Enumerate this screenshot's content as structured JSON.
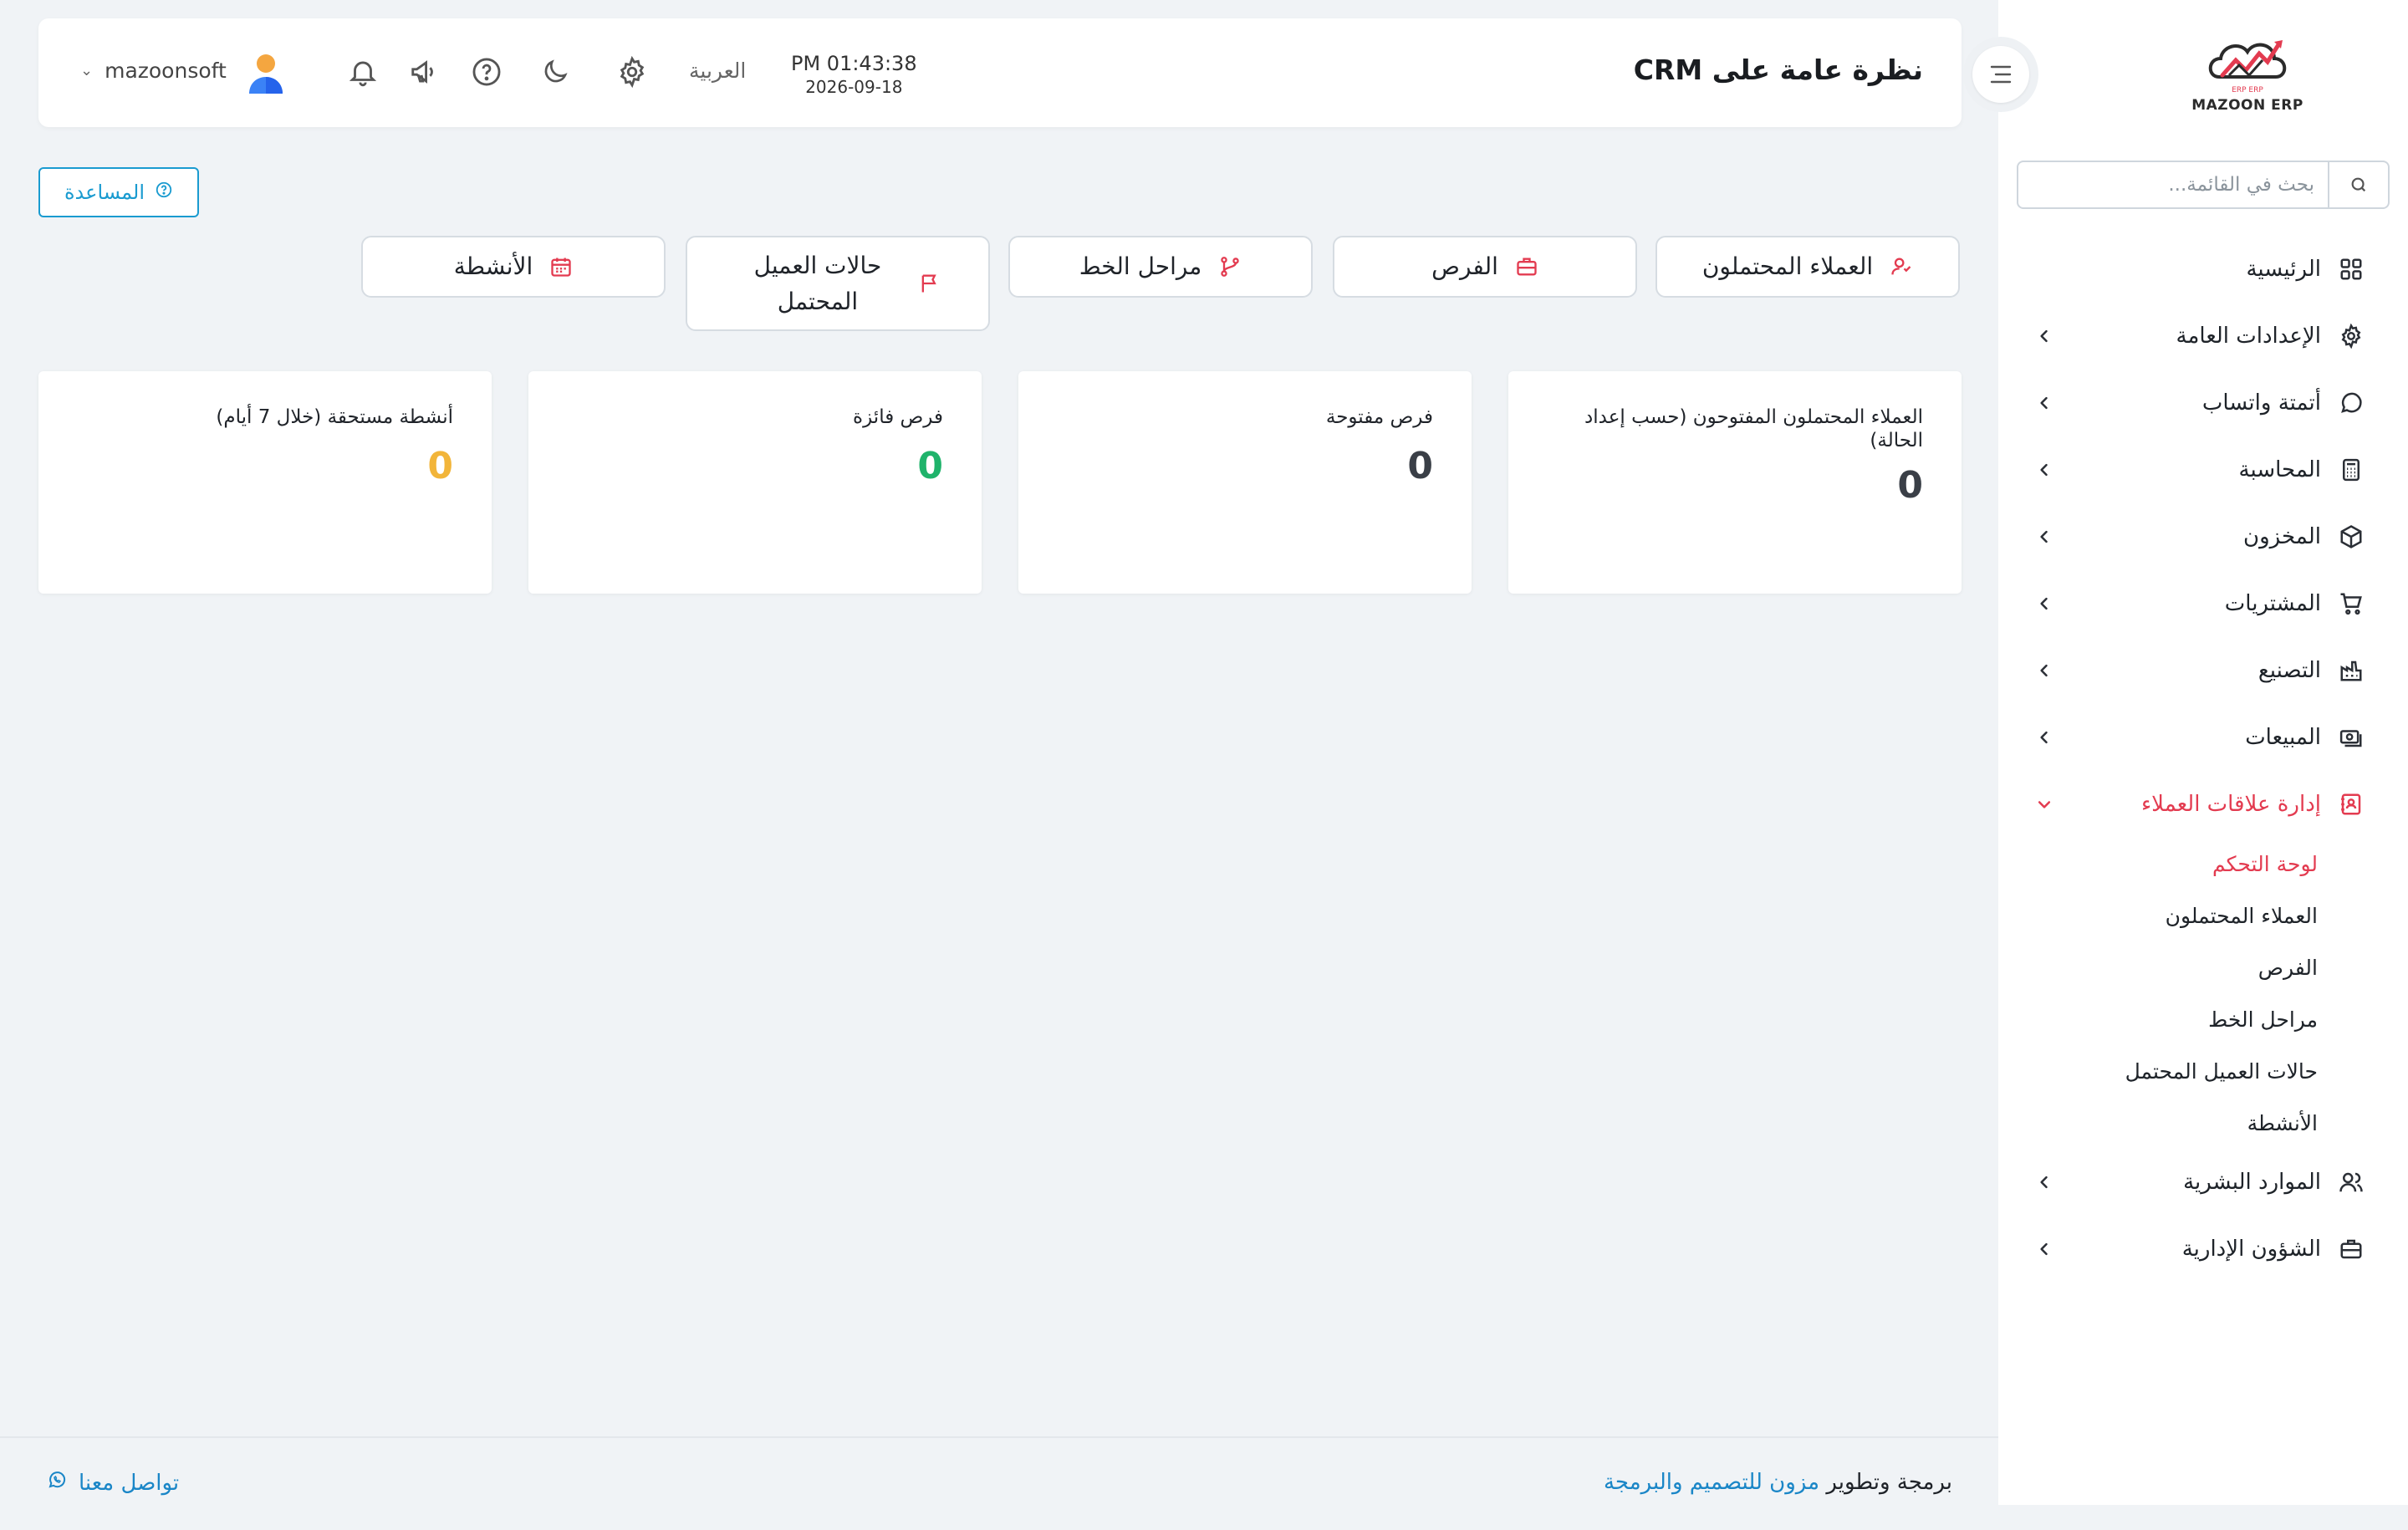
{
  "app": {
    "brand_name": "MAZOON ERP",
    "brand_tag": "ERP ERP",
    "accent_color": "#e33b50",
    "link_color": "#1a86c7"
  },
  "header": {
    "page_title": "نظرة عامة على CRM",
    "time": "PM 01:43:38",
    "date": "2026-09-18",
    "language": "العربية",
    "username": "mazoonsoft"
  },
  "sidebar": {
    "search_placeholder": "بحث في القائمة...",
    "items": [
      {
        "label": "الرئيسية",
        "icon": "grid-icon",
        "expandable": false
      },
      {
        "label": "الإعدادات العامة",
        "icon": "gear-icon",
        "expandable": true
      },
      {
        "label": "أتمتة واتساب",
        "icon": "whatsapp-icon",
        "expandable": true
      },
      {
        "label": "المحاسبة",
        "icon": "calculator-icon",
        "expandable": true
      },
      {
        "label": "المخزون",
        "icon": "box-icon",
        "expandable": true
      },
      {
        "label": "المشتريات",
        "icon": "cart-icon",
        "expandable": true
      },
      {
        "label": "التصنيع",
        "icon": "factory-icon",
        "expandable": true
      },
      {
        "label": "المبيعات",
        "icon": "cash-icon",
        "expandable": true
      },
      {
        "label": "إدارة علاقات العملاء",
        "icon": "contacts-icon",
        "expandable": true,
        "active": true
      },
      {
        "label": "الموارد البشرية",
        "icon": "users-icon",
        "expandable": true
      },
      {
        "label": "الشؤون الإدارية",
        "icon": "briefcase-icon",
        "expandable": true
      }
    ],
    "crm_submenu": [
      {
        "label": "لوحة التحكم",
        "active": true
      },
      {
        "label": "العملاء المحتملون"
      },
      {
        "label": "الفرص"
      },
      {
        "label": "مراحل الخط"
      },
      {
        "label": "حالات العميل المحتمل"
      },
      {
        "label": "الأنشطة"
      }
    ]
  },
  "help_button": "المساعدة",
  "quick_nav": [
    {
      "label": "العملاء المحتملون",
      "icon": "user-icon"
    },
    {
      "label": "الفرص",
      "icon": "briefcase-icon"
    },
    {
      "label": "مراحل الخط",
      "icon": "git-branch-icon"
    },
    {
      "label": "حالات العميل المحتمل",
      "icon": "flag-icon"
    },
    {
      "label": "الأنشطة",
      "icon": "calendar-icon"
    }
  ],
  "kpis": [
    {
      "label": "العملاء المحتملون المفتوحون (حسب إعداد الحالة)",
      "value": "0",
      "color": "#3a3f47"
    },
    {
      "label": "فرص مفتوحة",
      "value": "0",
      "color": "#3a3f47"
    },
    {
      "label": "فرص فائزة",
      "value": "0",
      "color": "#1fb36b"
    },
    {
      "label": "أنشطة مستحقة (خلال 7 أيام)",
      "value": "0",
      "color": "#f2b53a"
    }
  ],
  "footer": {
    "credit_prefix": "برمجة وتطوير",
    "credit_link": "مزون للتصميم والبرمجة",
    "contact": "تواصل معنا"
  }
}
